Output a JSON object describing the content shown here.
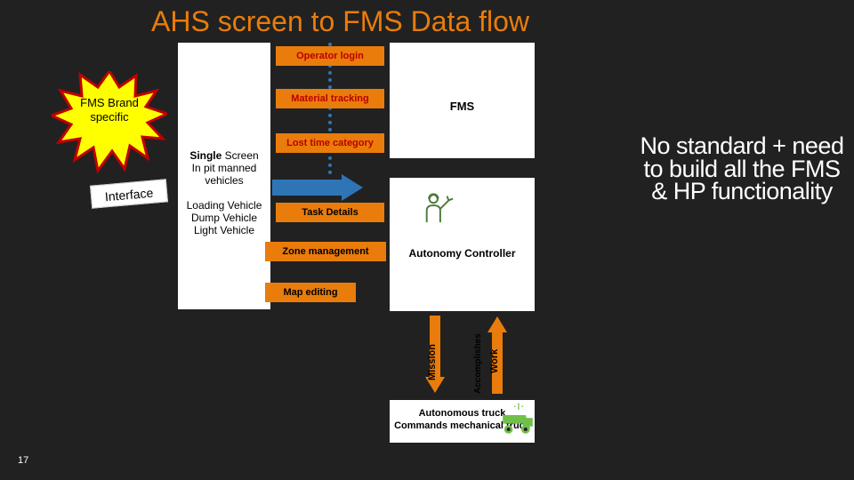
{
  "title": "AHS screen to FMS  Data flow",
  "left_col": {
    "l1_bold": "Single",
    "l1_rest": " Screen",
    "l2": "In pit manned",
    "l3": "vehicles",
    "l4": "Loading Vehicle",
    "l5": "Dump Vehicle",
    "l6": "Light Vehicle"
  },
  "pills": {
    "p1": "Operator login",
    "p2": "Material tracking",
    "p3": "Lost time category",
    "p4": "Task Details",
    "p5": "Zone management",
    "p6": "Map editing"
  },
  "right_top": "FMS",
  "right_mid": "Autonomy Controller",
  "bottom": {
    "l1": "Autonomous truck",
    "l2": "Commands mechanical truck"
  },
  "vert_labels": {
    "mission": "Mission",
    "work": "Work",
    "acc": "Accomplishes"
  },
  "burst": {
    "l1": "FMS Brand",
    "l2": "specific"
  },
  "interface": "Interface",
  "callout": "No standard + need to build all the FMS & HP functionality",
  "page": "17"
}
